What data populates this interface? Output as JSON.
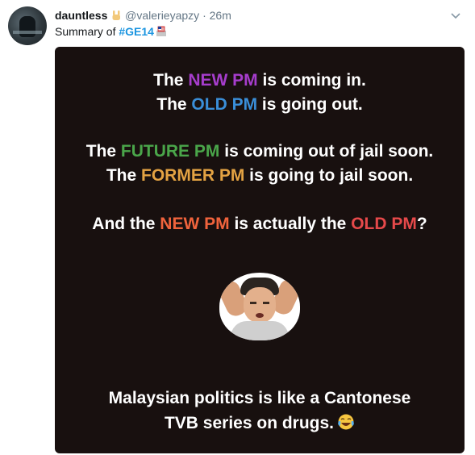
{
  "tweet": {
    "display_name": "dauntless",
    "handle": "@valerieyapzy",
    "separator": "·",
    "time": "26m",
    "text_prefix": "Summary of ",
    "hashtag": "#GE14",
    "icons": {
      "avatar": "profile-photo",
      "name_emoji": "rock-hand-emoji-icon",
      "hashtag_emoji": "malaysia-flag-ballot-emoji-icon",
      "menu": "chevron-down-icon"
    }
  },
  "image": {
    "l1": {
      "a": "The ",
      "b": "NEW PM",
      "c": " is coming in."
    },
    "l2": {
      "a": "The ",
      "b": "OLD PM",
      "c": " is going out."
    },
    "l3": {
      "a": "The ",
      "b": "FUTURE PM",
      "c": " is coming out of jail soon."
    },
    "l4": {
      "a": "The ",
      "b": "FORMER PM",
      "c": " is going to jail soon."
    },
    "l5": {
      "a": "And the ",
      "b": "NEW PM",
      "c": " is actually the ",
      "d": "OLD PM",
      "e": "?"
    },
    "l6": "Malaysian politics is like a Cantonese",
    "l7": "TVB series on drugs.",
    "icons": {
      "face": "confused-man-meme-icon",
      "laugh": "tears-of-joy-emoji-icon"
    },
    "colors": {
      "background": "#18100f",
      "new_pm": "#a63dcc",
      "old_pm": "#3a8ed8",
      "future_pm": "#4aa64a",
      "former_pm": "#e4a343",
      "new_pm_2": "#f0633c",
      "old_pm_2": "#e6494a"
    }
  }
}
